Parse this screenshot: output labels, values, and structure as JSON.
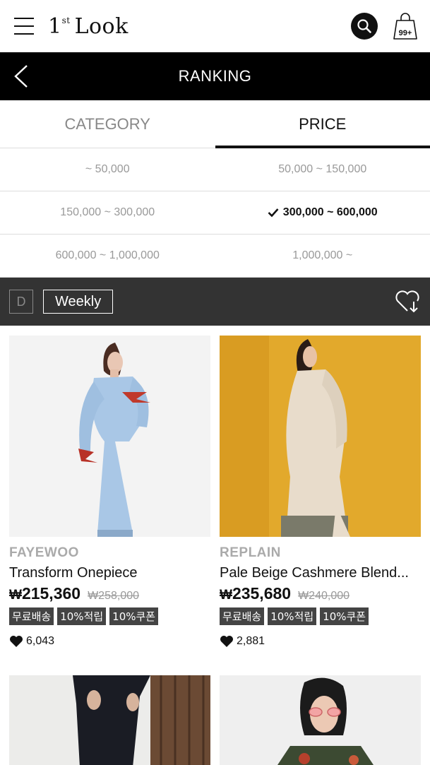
{
  "header": {
    "logo_number": "1",
    "logo_superscript": "st",
    "logo_word": "Look",
    "cart_count": "99+"
  },
  "ranking_bar": {
    "title": "RANKING"
  },
  "tabs": [
    {
      "label": "CATEGORY",
      "active": false
    },
    {
      "label": "PRICE",
      "active": true
    }
  ],
  "price_filters": [
    {
      "label": "~ 50,000",
      "selected": false
    },
    {
      "label": "50,000 ~ 150,000",
      "selected": false
    },
    {
      "label": "150,000 ~ 300,000",
      "selected": false
    },
    {
      "label": "300,000 ~ 600,000",
      "selected": true
    },
    {
      "label": "600,000 ~ 1,000,000",
      "selected": false
    },
    {
      "label": "1,000,000 ~",
      "selected": false
    }
  ],
  "filter_bar": {
    "daily_label": "D",
    "weekly_label": "Weekly"
  },
  "products": [
    {
      "brand": "FAYEWOO",
      "name": "Transform Onepiece",
      "currency": "₩",
      "price": "215,360",
      "original_price": "₩258,000",
      "badges": [
        "무료배송",
        "10%적립",
        "10%쿠폰"
      ],
      "likes": "6,043",
      "image_bg": "#f2f2f2"
    },
    {
      "brand": "REPLAIN",
      "name": "Pale Beige Cashmere Blend...",
      "currency": "₩",
      "price": "235,680",
      "original_price": "₩240,000",
      "badges": [
        "무료배송",
        "10%적립",
        "10%쿠폰"
      ],
      "likes": "2,881",
      "image_bg": "#e2a92c"
    }
  ],
  "colors": {
    "black": "#000000",
    "dark_bar": "#333333",
    "muted": "#999999"
  }
}
